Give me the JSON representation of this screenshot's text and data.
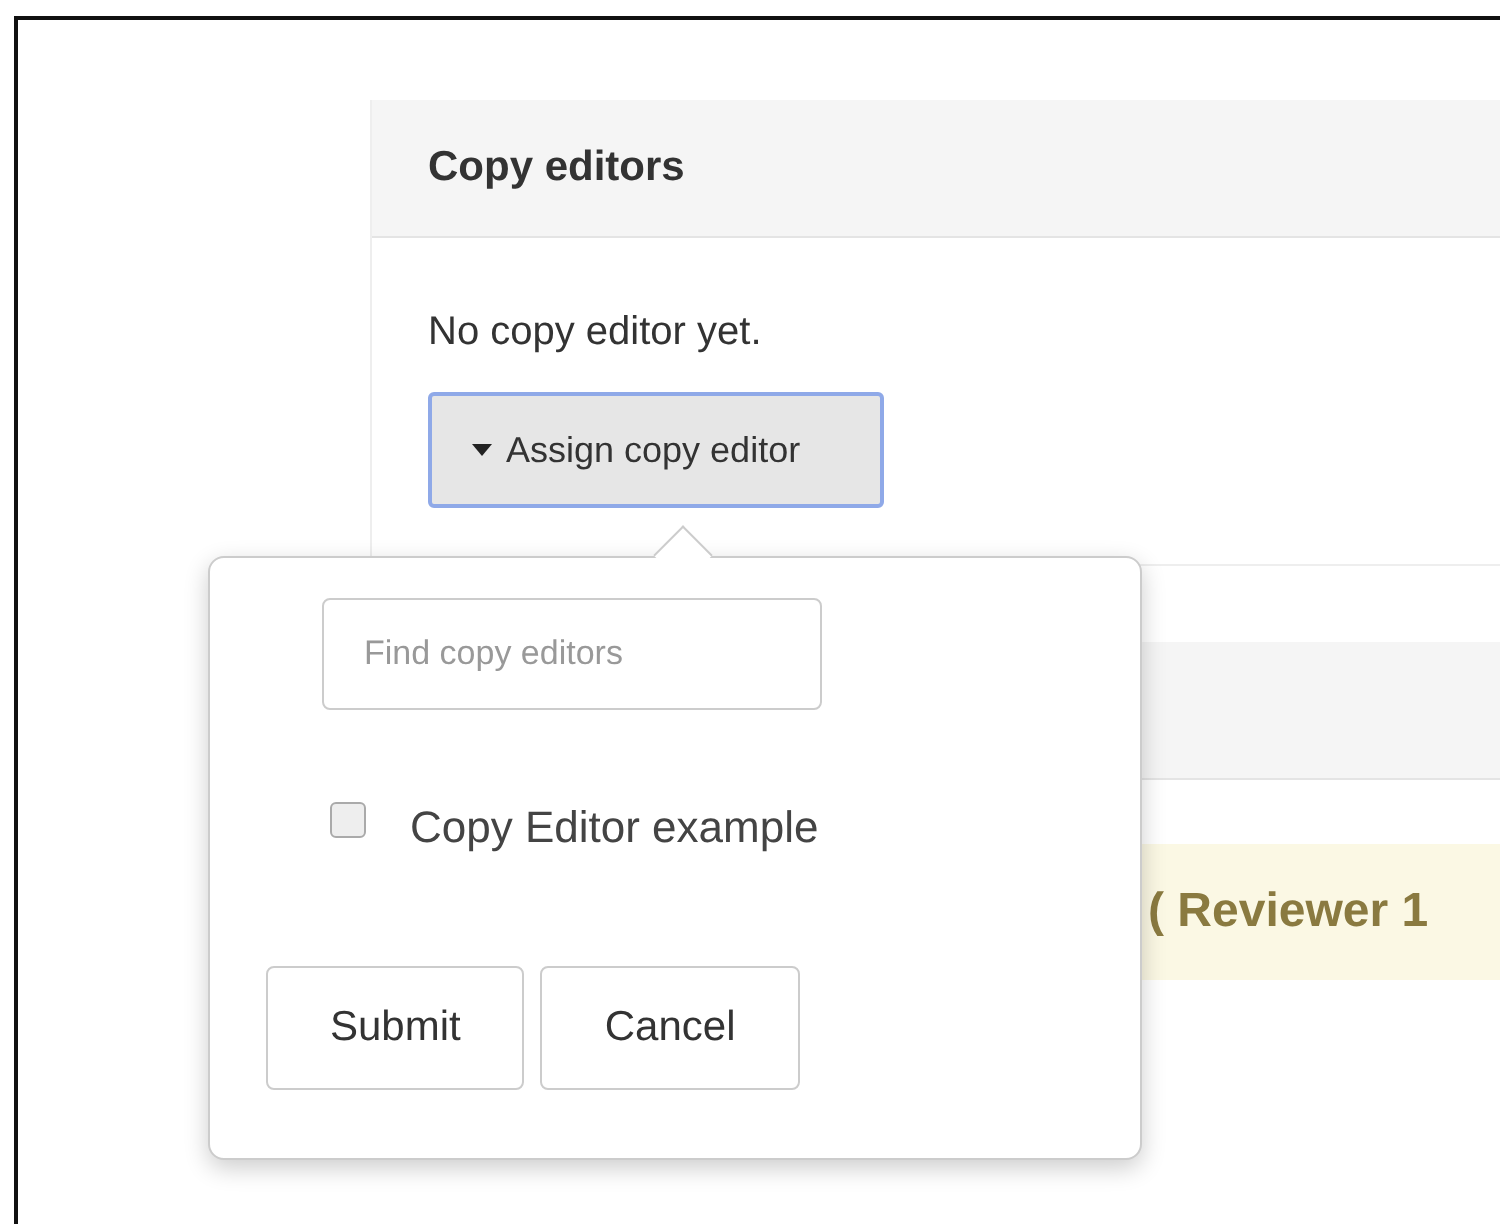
{
  "panel": {
    "title": "Copy editors",
    "empty_message": "No copy editor yet.",
    "assign_button": {
      "label": "Assign copy editor",
      "expanded": true
    }
  },
  "popover": {
    "search": {
      "placeholder": "Find copy editors"
    },
    "options": [
      {
        "label": "Copy Editor example",
        "checked": false
      }
    ],
    "buttons": [
      "Submit",
      "Cancel"
    ]
  },
  "review_row": {
    "text": "( Reviewer 1"
  }
}
